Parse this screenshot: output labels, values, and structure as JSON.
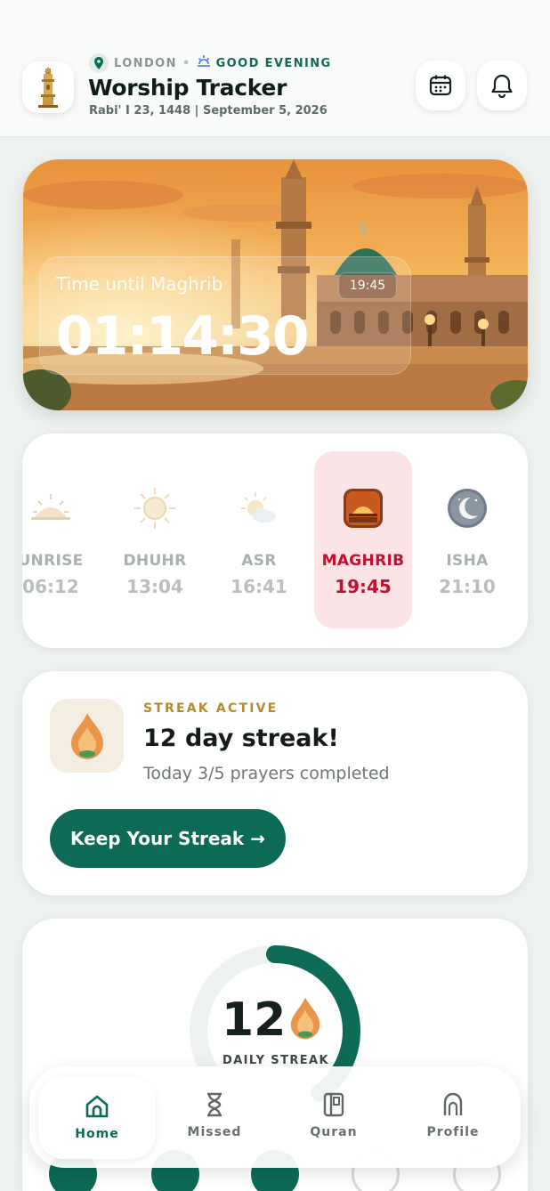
{
  "header": {
    "location": "LONDON",
    "separator": "•",
    "greeting": "GOOD EVENING",
    "title": "Worship Tracker",
    "date": "Rabi' I 23, 1448 | September 5, 2026",
    "icons": [
      "location-pin-icon",
      "sunset-icon",
      "calendar-icon",
      "bell-icon",
      "minaret-logo-icon"
    ]
  },
  "hero": {
    "label": "Time until Maghrib",
    "countdown": "01:14:30",
    "prayer_time": "19:45"
  },
  "prayers": [
    {
      "name": "UNRISE",
      "time": "06:12",
      "icon": "sunrise-icon",
      "active": false
    },
    {
      "name": "DHUHR",
      "time": "13:04",
      "icon": "sun-icon",
      "active": false
    },
    {
      "name": "ASR",
      "time": "16:41",
      "icon": "sun-cloud-icon",
      "active": false
    },
    {
      "name": "MAGHRIB",
      "time": "19:45",
      "icon": "sunset-icon",
      "active": true
    },
    {
      "name": "ISHA",
      "time": "21:10",
      "icon": "crescent-moon-icon",
      "active": false
    }
  ],
  "streak": {
    "label": "STREAK ACTIVE",
    "title": "12 day streak!",
    "subtitle": "Today 3/5 prayers completed",
    "button": "Keep Your Streak →"
  },
  "daily": {
    "count": "12",
    "label": "DAILY STREAK",
    "progress_percent": 40
  },
  "nav": [
    {
      "label": "Home",
      "icon": "home-icon",
      "active": true
    },
    {
      "label": "Missed",
      "icon": "hourglass-icon",
      "active": false
    },
    {
      "label": "Quran",
      "icon": "book-icon",
      "active": false
    },
    {
      "label": "Profile",
      "icon": "mihrab-icon",
      "active": false
    }
  ],
  "colors": {
    "accent": "#0d6a57",
    "active_prayer": "#c2102f",
    "streak_label": "#b48a2f"
  }
}
